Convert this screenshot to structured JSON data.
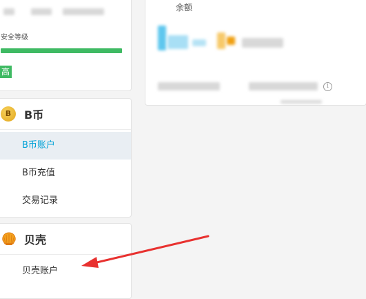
{
  "security": {
    "label": "安全等级",
    "level_badge": "高",
    "level_fraction": 1.0,
    "bar_color": "#3fba63"
  },
  "bcoin": {
    "title": "B币",
    "icon": "coin-icon",
    "items": [
      {
        "label": "B币账户",
        "active": true
      },
      {
        "label": "B币充值",
        "active": false
      },
      {
        "label": "交易记录",
        "active": false
      }
    ],
    "active_color": "#00a1d6"
  },
  "shell": {
    "title": "贝壳",
    "icon": "shell-icon",
    "items": [
      {
        "label": "贝壳账户",
        "active": false
      }
    ]
  },
  "balance": {
    "label": "余额",
    "info_icon": "info-icon"
  },
  "annotation": {
    "arrow_color": "#e8312f"
  }
}
